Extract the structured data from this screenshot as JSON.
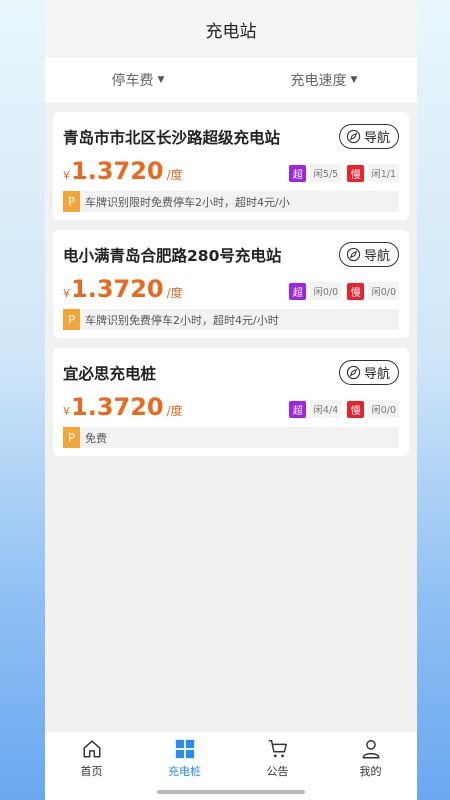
{
  "header": {
    "title": "充电站"
  },
  "filters": [
    {
      "label": "停车费"
    },
    {
      "label": "充电速度"
    }
  ],
  "stations": [
    {
      "name": "青岛市市北区长沙路超级充电站",
      "nav_label": "导航",
      "price_symbol": "¥",
      "price": "1.3720",
      "unit": "/度",
      "super_badge": "超",
      "super_idle": "闲5/5",
      "slow_badge": "慢",
      "slow_idle": "闲1/1",
      "park_icon": "P",
      "parking": "车牌识别限时免费停车2小时，超时4元/小"
    },
    {
      "name": "电小满青岛合肥路280号充电站",
      "nav_label": "导航",
      "price_symbol": "¥",
      "price": "1.3720",
      "unit": "/度",
      "super_badge": "超",
      "super_idle": "闲0/0",
      "slow_badge": "慢",
      "slow_idle": "闲0/0",
      "park_icon": "P",
      "parking": "车牌识别免费停车2小时，超时4元/小时"
    },
    {
      "name": "宜必思充电桩",
      "nav_label": "导航",
      "price_symbol": "¥",
      "price": "1.3720",
      "unit": "/度",
      "super_badge": "超",
      "super_idle": "闲4/4",
      "slow_badge": "慢",
      "slow_idle": "闲0/0",
      "park_icon": "P",
      "parking": "免费"
    }
  ],
  "tabbar": [
    {
      "label": "首页",
      "icon": "home-icon"
    },
    {
      "label": "充电桩",
      "icon": "grid-icon"
    },
    {
      "label": "公告",
      "icon": "cart-icon"
    },
    {
      "label": "我的",
      "icon": "user-icon"
    }
  ],
  "colors": {
    "accent": "#2a8cf0",
    "price": "#e86a1e",
    "super_badge": "#9b27e0",
    "slow_badge": "#e8232e",
    "parking": "#f3a537"
  }
}
